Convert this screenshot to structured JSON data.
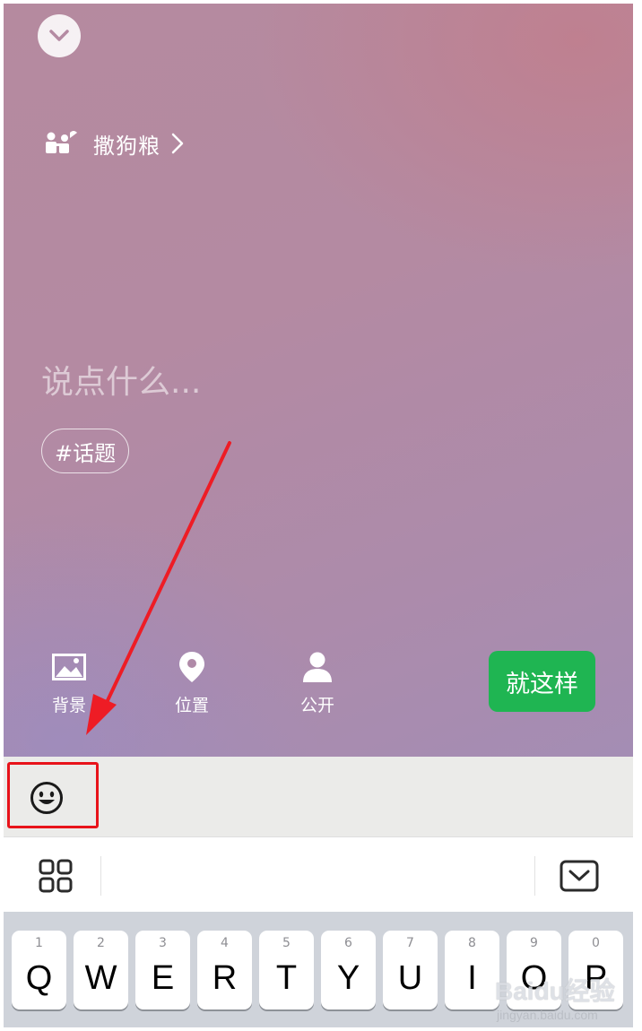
{
  "compose": {
    "topic": "撒狗粮",
    "placeholder": "说点什么...",
    "hashtag": "#话题",
    "tools": [
      {
        "label": "背景",
        "icon": "image-icon"
      },
      {
        "label": "位置",
        "icon": "location-pin-icon"
      },
      {
        "label": "公开",
        "icon": "person-icon"
      }
    ],
    "send_label": "就这样",
    "accent": "#1fb552"
  },
  "emoji_bar": {
    "icon": "smiley-face-icon",
    "highlight_color": "#e8131a"
  },
  "keyboard": {
    "toolbar_icons": [
      "grid-icon",
      "keyboard-hide-icon"
    ],
    "keys": [
      {
        "num": "1",
        "char": "Q"
      },
      {
        "num": "2",
        "char": "W"
      },
      {
        "num": "3",
        "char": "E"
      },
      {
        "num": "4",
        "char": "R"
      },
      {
        "num": "5",
        "char": "T"
      },
      {
        "num": "6",
        "char": "Y"
      },
      {
        "num": "7",
        "char": "U"
      },
      {
        "num": "8",
        "char": "I"
      },
      {
        "num": "9",
        "char": "O"
      },
      {
        "num": "0",
        "char": "P"
      }
    ]
  },
  "watermark": {
    "title": "Baidu经验",
    "subtitle": "jingyan.baidu.com"
  }
}
